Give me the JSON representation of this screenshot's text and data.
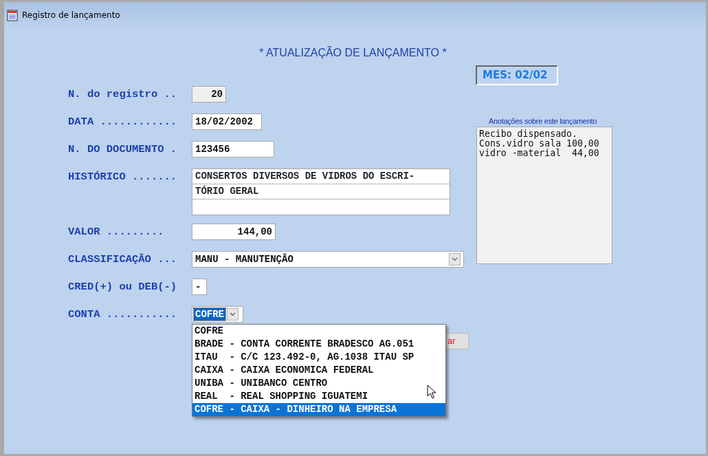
{
  "window": {
    "title": "Registro de lançamento"
  },
  "heading": "* ATUALIZAÇÃO DE LANÇAMENTO *",
  "month_badge": "MES: 02/02",
  "fields": [
    {
      "kind": "readonly",
      "label": "N. do registro ..",
      "value": "20"
    },
    {
      "kind": "text",
      "label": "DATA ............",
      "value": "18/02/2002"
    },
    {
      "kind": "text",
      "label": "N. DO DOCUMENTO .",
      "value": "123456"
    },
    {
      "kind": "multiline",
      "label": "HISTÓRICO .......",
      "lines": [
        "CONSERTOS DIVERSOS DE VIDROS DO ESCRI-",
        "TÓRIO GERAL"
      ]
    },
    {
      "kind": "number",
      "label": "VALOR .........",
      "value": "144,00"
    },
    {
      "kind": "select",
      "label": "CLASSIFICAÇÃO ...",
      "value": "MANU - MANUTENÇÃO"
    },
    {
      "kind": "sign",
      "label": "CRED(+) ou DEB(-)",
      "value": "-"
    },
    {
      "kind": "dropdown",
      "label": "CONTA ...........",
      "value": "COFRE",
      "options": [
        {
          "label": "COFRE",
          "highlighted": false
        },
        {
          "label": "BRADE - CONTA CORRENTE BRADESCO AG.051",
          "highlighted": false
        },
        {
          "label": "ITAU  - C/C 123.492-0, AG.1038 ITAU SP",
          "highlighted": false
        },
        {
          "label": "CAIXA - CAIXA ECONOMICA FEDERAL",
          "highlighted": false
        },
        {
          "label": "UNIBA - UNIBANCO CENTRO",
          "highlighted": false
        },
        {
          "label": "REAL  - REAL SHOPPING IGUATEMI",
          "highlighted": false
        },
        {
          "label": "COFRE - CAIXA - DINHEIRO NA EMPRESA",
          "highlighted": true
        }
      ]
    }
  ],
  "hidden_button": {
    "label": "ar"
  },
  "notes": {
    "label": "Anotações sobre este lançamento",
    "text": "Recibo dispensado.\nCons.vidro sala 100,00\nvidro -material  44,00"
  }
}
